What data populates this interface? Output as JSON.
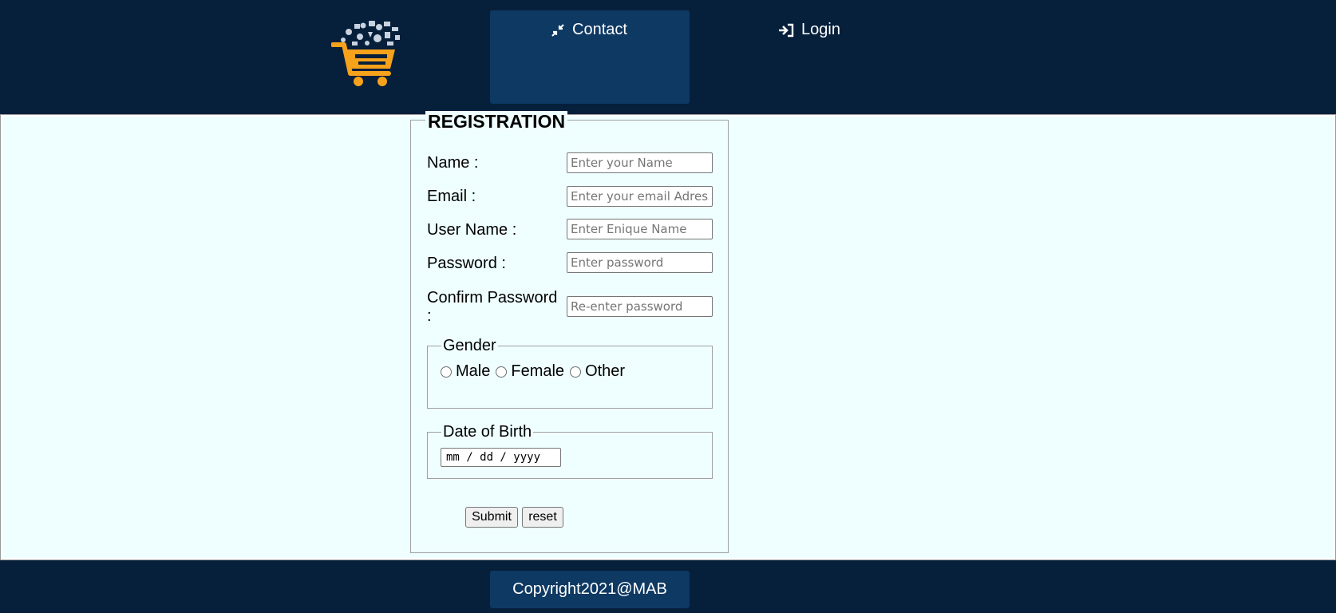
{
  "header": {
    "nav": {
      "contact_label": "Contact",
      "login_label": "Login"
    }
  },
  "registration": {
    "title": "REGISTRATION",
    "fields": [
      {
        "label": "Name :",
        "placeholder": "Enter your Name"
      },
      {
        "label": "Email :",
        "placeholder": "Enter your email Adress"
      },
      {
        "label": "User Name :",
        "placeholder": "Enter Enique Name"
      },
      {
        "label": "Password :",
        "placeholder": "Enter password"
      },
      {
        "label": "Confirm Password :",
        "placeholder": "Re-enter password"
      }
    ],
    "gender": {
      "legend": "Gender",
      "options": [
        "Male",
        "Female",
        "Other"
      ]
    },
    "dob": {
      "legend": "Date of Birth",
      "format": "mm / dd / yyyy"
    },
    "buttons": {
      "submit": "Submit",
      "reset": "reset"
    }
  },
  "footer": {
    "copyright": "Copyright2021@MAB"
  },
  "colors": {
    "navy": "#061f3b",
    "nav_active": "#0e3963",
    "content_bg": "#efffff",
    "cart_orange": "#f7a21b"
  },
  "icons": {
    "contact": "compress-arrows-icon",
    "login": "sign-in-icon",
    "logo": "shopping-cart-logo"
  }
}
